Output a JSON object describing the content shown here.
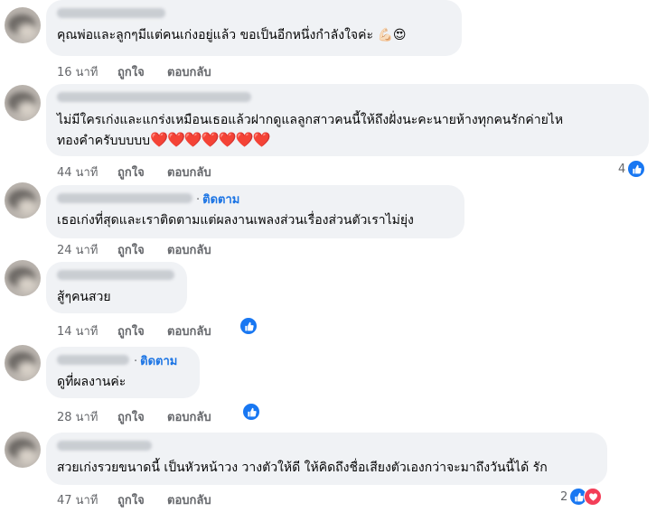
{
  "comments": [
    {
      "text": "คุณพ่อและลูกๆมีแต่คนเก่งอยู่แล้ว ขอเป็นอีกหนึ่งกำลังใจค่ะ",
      "emojis": "💪🏻😍",
      "time": "16 นาที",
      "like": "ถูกใจ",
      "reply": "ตอบกลับ"
    },
    {
      "text_line1": "ไม่มีใครเก่งและแกร่งเหมือนเธอแล้วฝากดูแลลูกสาวคนนี้ให้ถึงฝั่งนะคะนายห้างทุกคนรักค่ายไห",
      "text_line2": "ทองคำครับบบบบ",
      "hearts": "❤️❤️❤️❤️❤️❤️❤️",
      "time": "44 นาที",
      "like": "ถูกใจ",
      "reply": "ตอบกลับ",
      "reaction_count": "4"
    },
    {
      "follow": "ติดตาม",
      "follow_dot": "·",
      "text": "เธอเก่งที่สุดและเราติดตามแต่ผลงานเพลงส่วนเรื่องส่วนตัวเราไม่ยุ่ง",
      "time": "24 นาที",
      "like": "ถูกใจ",
      "reply": "ตอบกลับ"
    },
    {
      "text": "สู้ๆคนสวย",
      "time": "14 นาที",
      "like": "ถูกใจ",
      "reply": "ตอบกลับ"
    },
    {
      "follow": "ติดตาม",
      "follow_dot": "·",
      "text": "ดูที่ผลงานค่ะ",
      "time": "28 นาที",
      "like": "ถูกใจ",
      "reply": "ตอบกลับ"
    },
    {
      "text": "สวยเก่งรวยขนาดนี้ เป็นหัวหน้าวง วางตัวให้ดี ให้คิดถึงชื่อเสียงตัวเองกว่าจะมาถึงวันนี้ได้ รัก",
      "time": "47 นาที",
      "like": "ถูกใจ",
      "reply": "ตอบกลับ",
      "reaction_count": "2"
    }
  ],
  "colors": {
    "bubble": "#f0f2f5",
    "link": "#1b74e4",
    "meta": "#65676b",
    "like_reaction": "#1877f2",
    "love_reaction": "#f33e58"
  },
  "icons": {
    "like_reaction": "thumbs-up-icon",
    "love_reaction": "heart-icon"
  }
}
